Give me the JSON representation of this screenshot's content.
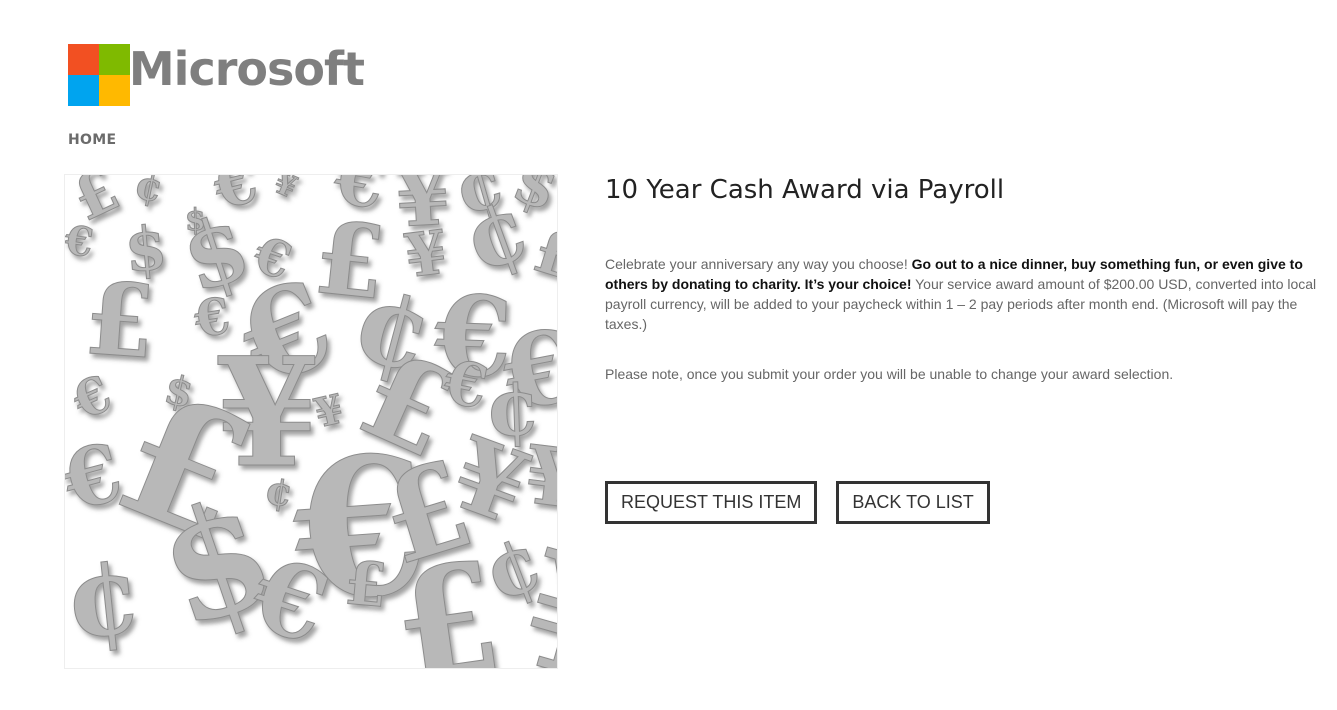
{
  "brand": {
    "name": "Microsoft",
    "colors": {
      "red": "#f25022",
      "green": "#7fba00",
      "blue": "#00a4ef",
      "yellow": "#ffb900"
    }
  },
  "nav": {
    "home_label": "HOME"
  },
  "product": {
    "title": "10 Year Cash Award via Payroll",
    "description_plain_intro": "Celebrate your anniversary any way you choose! ",
    "description_bold": "Go out to a nice dinner, buy something fun, or even give to others by donating to charity. It’s your choice!",
    "description_plain_rest": " Your service award amount of $200.00 USD, converted into local payroll currency, will be added to your paycheck within 1 – 2 pay periods after month end. (Microsoft will pay the taxes.)",
    "note": "Please note, once you submit your order you will be unable to change your award selection.",
    "image_icon": "currency-symbols-icon"
  },
  "actions": {
    "request_label": "REQUEST THIS ITEM",
    "back_label": "BACK TO LIST"
  }
}
